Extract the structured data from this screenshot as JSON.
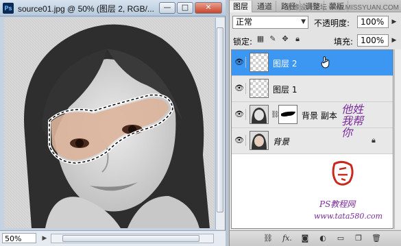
{
  "document": {
    "title": "source01.jpg @ 50% (图层 2, RGB/...",
    "app_icon": "Ps",
    "zoom": "50%",
    "window_buttons": {
      "minimize": "—",
      "maximize": "□",
      "close": "✕"
    }
  },
  "panel": {
    "tabs": [
      {
        "label": "图层",
        "active": true
      },
      {
        "label": "通道",
        "active": false
      },
      {
        "label": "路径",
        "active": false
      },
      {
        "label": "调整",
        "active": false
      },
      {
        "label": "蒙版",
        "active": false
      }
    ],
    "top_watermark": "思缘设计论坛 www.MISSYUAN.COM",
    "blend_mode": "正常",
    "opacity_label": "不透明度:",
    "opacity_value": "100%",
    "lock_label": "锁定:",
    "fill_label": "填充:",
    "fill_value": "100%",
    "layers": [
      {
        "name": "图层 2",
        "selected": true,
        "thumb": "transparent"
      },
      {
        "name": "图层 1",
        "selected": false,
        "thumb": "transparent"
      },
      {
        "name": "背景 副本",
        "selected": false,
        "thumb": "photo-with-mask"
      },
      {
        "name": "背景",
        "selected": false,
        "thumb": "photo",
        "locked": true
      }
    ],
    "calligraphy": [
      "他",
      "姓",
      "我",
      "帮",
      "你"
    ],
    "brand_line1": "PS教程网",
    "brand_line2": "www.tata580.com",
    "accent_color": "#3c97f2"
  }
}
